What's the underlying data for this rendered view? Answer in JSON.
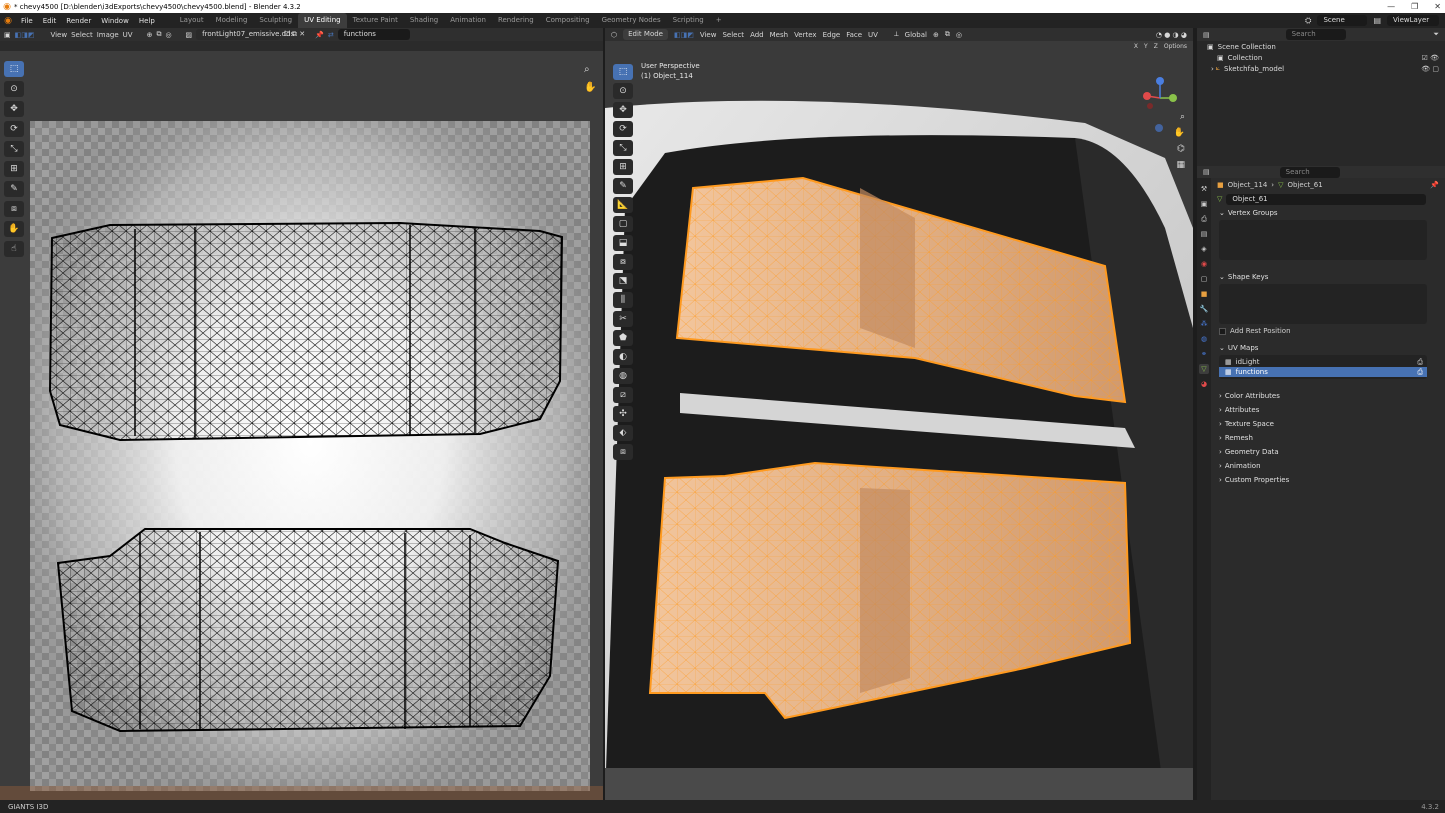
{
  "window": {
    "title": "* chevy4500 [D:\\blender\\i3dExports\\chevy4500\\chevy4500.blend] - Blender 4.3.2"
  },
  "menu": [
    "File",
    "Edit",
    "Render",
    "Window",
    "Help"
  ],
  "workspaces": [
    "Layout",
    "Modeling",
    "Sculpting",
    "UV Editing",
    "Texture Paint",
    "Shading",
    "Animation",
    "Rendering",
    "Compositing",
    "Geometry Nodes",
    "Scripting"
  ],
  "active_workspace": "UV Editing",
  "topright": {
    "scene": "Scene",
    "viewlayer": "ViewLayer"
  },
  "uv_editor": {
    "menus": [
      "View",
      "Select",
      "Image",
      "UV"
    ],
    "image_name": "frontLight07_emissive.dds",
    "uv_map": "functions"
  },
  "viewport": {
    "mode": "Edit Mode",
    "menus": [
      "View",
      "Select",
      "Add",
      "Mesh",
      "Vertex",
      "Edge",
      "Face",
      "UV"
    ],
    "orientation": "Global",
    "options": "Options",
    "overlay_line1": "User Perspective",
    "overlay_line2": "(1) Object_114",
    "axes": {
      "x": "X",
      "y": "Y",
      "z": "Z"
    }
  },
  "outliner": {
    "search_placeholder": "Search",
    "scene_collection": "Scene Collection",
    "collection": "Collection",
    "object": "Sketchfab_model"
  },
  "properties": {
    "search_placeholder": "Search",
    "breadcrumb_object": "Object_114",
    "breadcrumb_mesh": "Object_61",
    "mesh_name": "Object_61",
    "panels": {
      "vertex_groups": "Vertex Groups",
      "shape_keys": "Shape Keys",
      "add_rest_position": "Add Rest Position",
      "uv_maps": "UV Maps",
      "color_attributes": "Color Attributes",
      "attributes": "Attributes",
      "texture_space": "Texture Space",
      "remesh": "Remesh",
      "geometry_data": "Geometry Data",
      "animation": "Animation",
      "custom_properties": "Custom Properties"
    },
    "uv_map_items": [
      "idLight",
      "functions"
    ],
    "selected_uv_map": "functions"
  },
  "statusbar": {
    "left": "GIANTS I3D",
    "version": "4.3.2"
  },
  "colors": {
    "accent": "#4772b3",
    "selection_orange": "#ff9a1f",
    "blender_orange": "#e87d0d"
  }
}
